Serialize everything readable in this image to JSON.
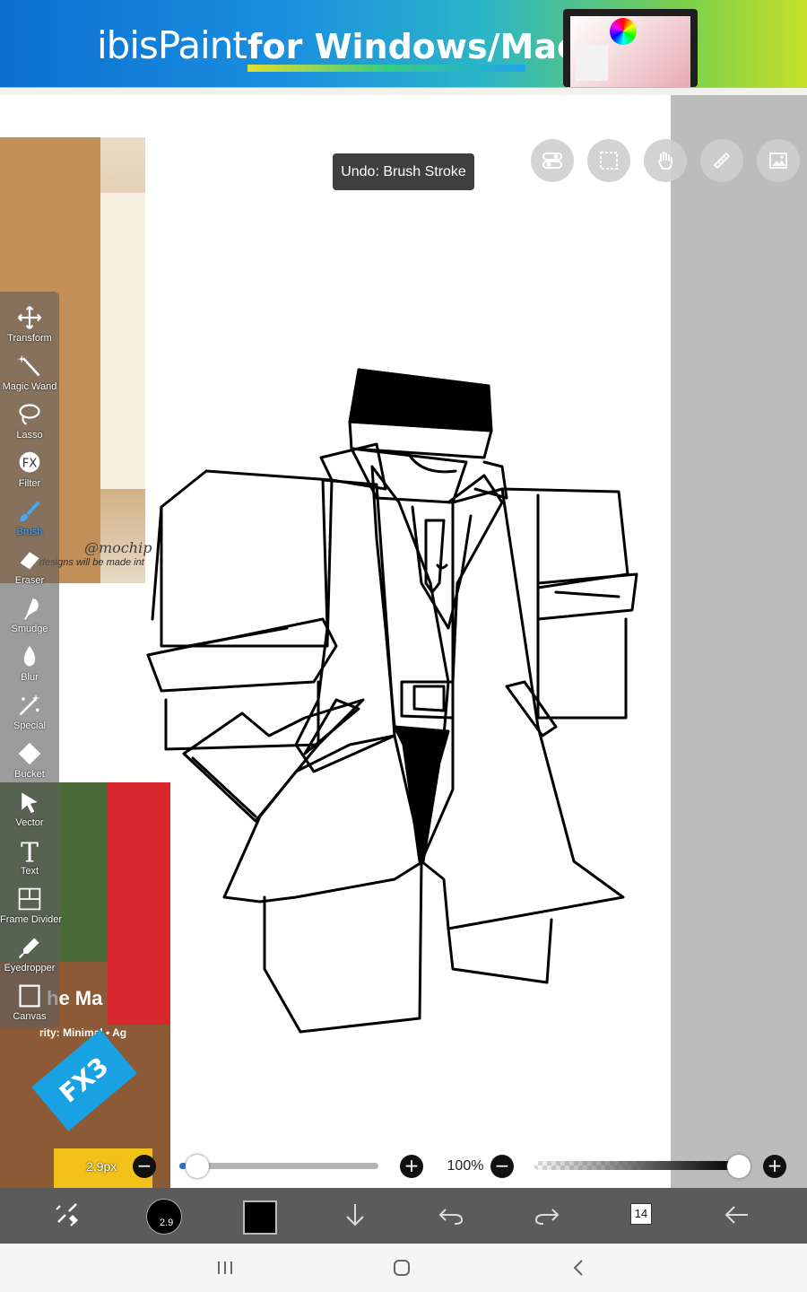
{
  "banner": {
    "brand": "ibisPaint",
    "tagline": "for Windows/Mac"
  },
  "toast": {
    "text": "Undo: Brush Stroke"
  },
  "reference_top": {
    "signature": "@mochip",
    "note": "designs will be made int"
  },
  "reference_bottom": {
    "caption": "he Ma",
    "subcaption": "rity: Minimal • Ag",
    "logo": "FX3"
  },
  "toolbar": {
    "tools": [
      {
        "label": "Transform",
        "icon": "transform-icon"
      },
      {
        "label": "Magic Wand",
        "icon": "magic-wand-icon"
      },
      {
        "label": "Lasso",
        "icon": "lasso-icon"
      },
      {
        "label": "Filter",
        "icon": "filter-icon"
      },
      {
        "label": "Brush",
        "icon": "brush-icon",
        "active": true
      },
      {
        "label": "Eraser",
        "icon": "eraser-icon"
      },
      {
        "label": "Smudge",
        "icon": "smudge-icon"
      },
      {
        "label": "Blur",
        "icon": "blur-icon"
      },
      {
        "label": "Special",
        "icon": "special-icon"
      },
      {
        "label": "Bucket",
        "icon": "bucket-icon"
      },
      {
        "label": "Vector",
        "icon": "vector-icon"
      },
      {
        "label": "Text",
        "icon": "text-icon"
      },
      {
        "label": "Frame Divider",
        "icon": "frame-divider-icon"
      },
      {
        "label": "Eyedropper",
        "icon": "eyedropper-icon"
      },
      {
        "label": "Canvas",
        "icon": "canvas-icon"
      }
    ]
  },
  "brush": {
    "size_label": "2.9px",
    "size_value": 2.9,
    "size_dot_label": "2.9",
    "color": "#000000"
  },
  "zoom": {
    "label": "100%"
  },
  "opacity": {
    "value": 1.0
  },
  "layers": {
    "count": "14"
  },
  "accent_color": "#3da9ff"
}
